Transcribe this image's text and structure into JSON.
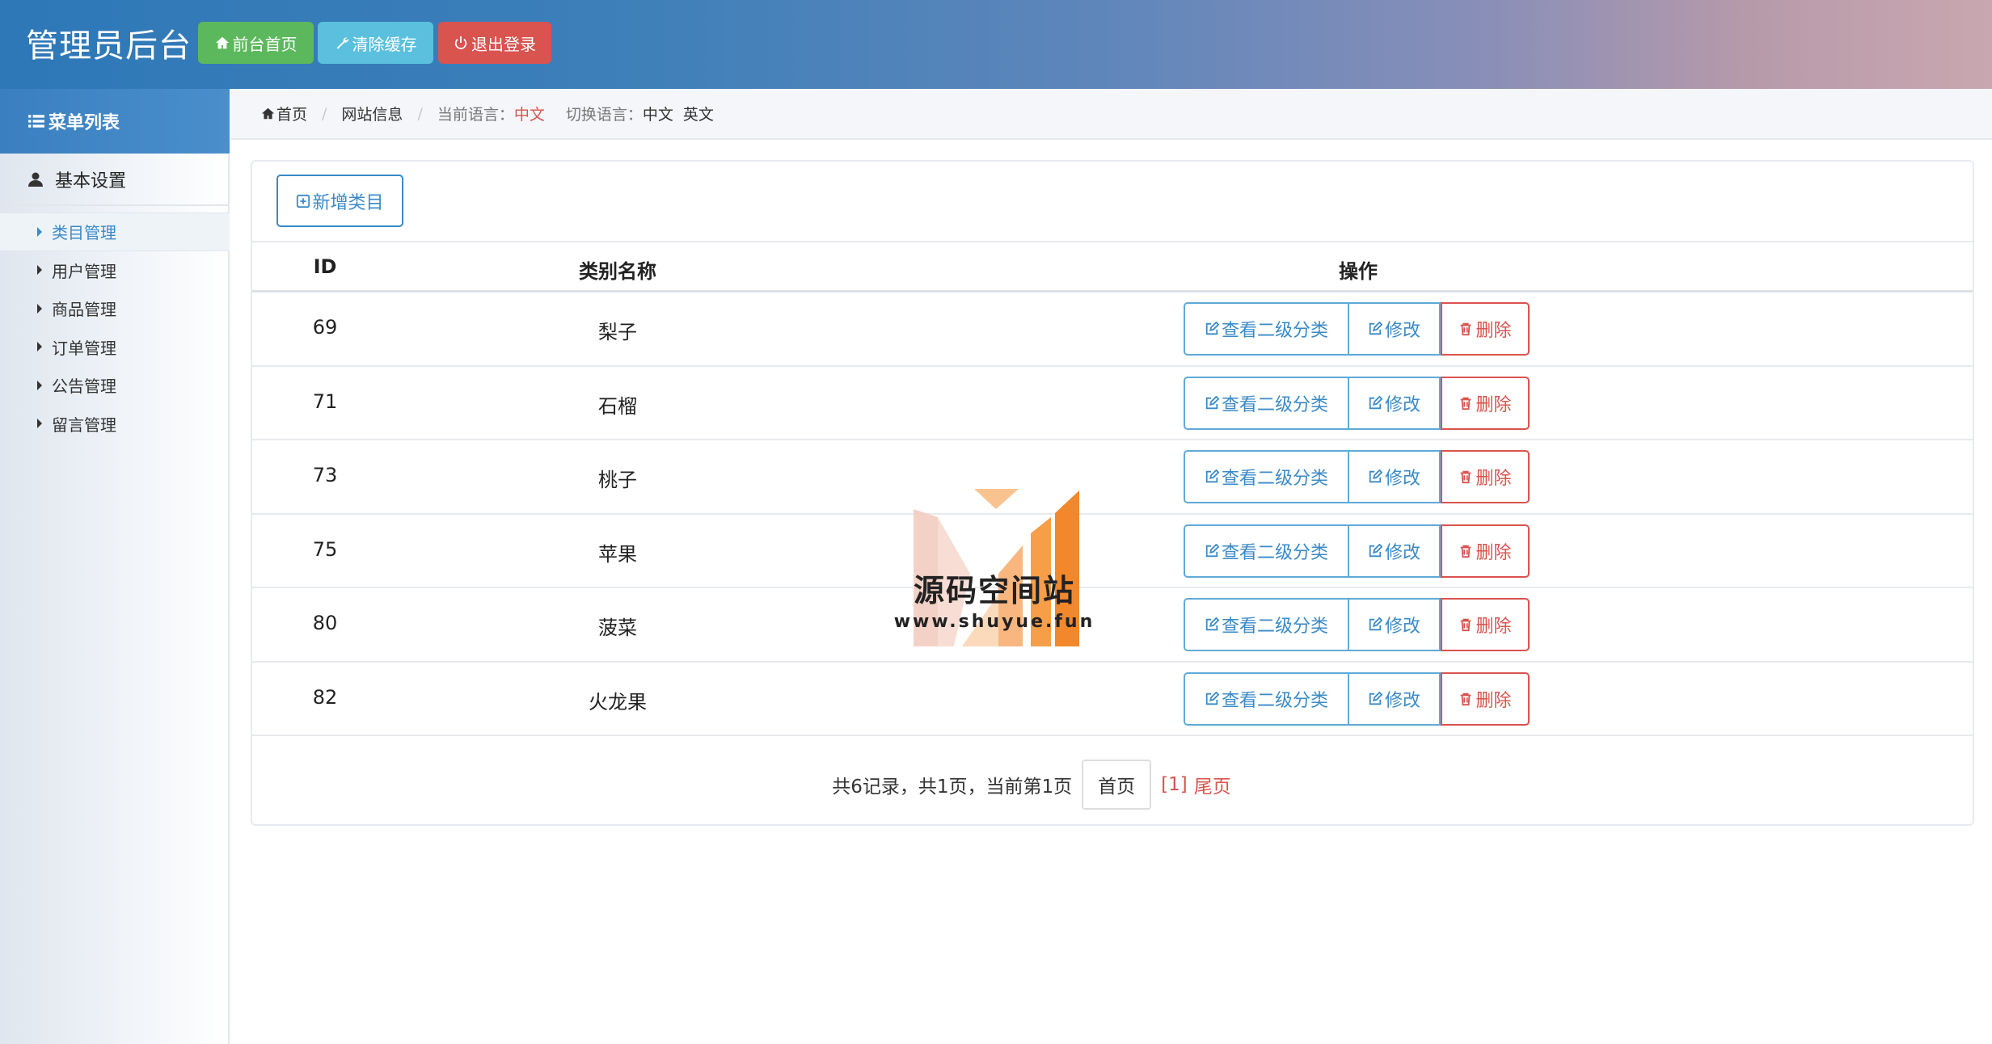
{
  "header": {
    "title": "管理员后台",
    "buttons": {
      "home": "前台首页",
      "cache": "清除缓存",
      "logout": "退出登录"
    },
    "colors": {
      "home": "#5cb85c",
      "cache": "#5bc0de",
      "logout": "#d9534f"
    }
  },
  "sidebar": {
    "menu_title": "菜单列表",
    "group": "基本设置",
    "items": [
      "类目管理",
      "用户管理",
      "商品管理",
      "订单管理",
      "公告管理",
      "留言管理"
    ],
    "active_index": 0
  },
  "breadcrumb": {
    "home": "首页",
    "site_info": "网站信息",
    "current_lang_label": "当前语言：",
    "current_lang": "中文",
    "switch_label": "切换语言：",
    "lang_cn": "中文",
    "lang_en": "英文"
  },
  "panel": {
    "add_button": "新增类目",
    "columns": {
      "id": "ID",
      "name": "类别名称",
      "ops": "操作"
    },
    "rows": [
      {
        "id": "69",
        "name": "梨子"
      },
      {
        "id": "71",
        "name": "石榴"
      },
      {
        "id": "73",
        "name": "桃子"
      },
      {
        "id": "75",
        "name": "苹果"
      },
      {
        "id": "80",
        "name": "菠菜"
      },
      {
        "id": "82",
        "name": "火龙果"
      }
    ],
    "row_actions": {
      "view": "查看二级分类",
      "edit": "修改",
      "delete": "删除"
    },
    "pager": {
      "summary": "共6记录，共1页，当前第1页",
      "first": "首页",
      "page": "[1]",
      "last": "尾页"
    }
  },
  "watermark": {
    "title": "源码空间站",
    "url": "www.shuyue.fun"
  }
}
